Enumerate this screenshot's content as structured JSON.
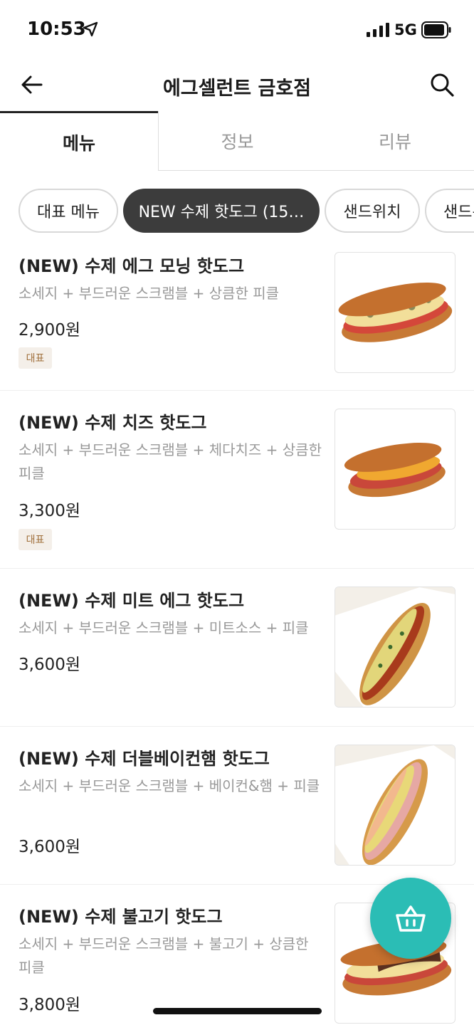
{
  "status": {
    "time": "10:53",
    "network": "5G"
  },
  "header": {
    "title": "에그셀런트 금호점"
  },
  "tabs": [
    {
      "label": "메뉴",
      "active": true
    },
    {
      "label": "정보",
      "active": false
    },
    {
      "label": "리뷰",
      "active": false
    }
  ],
  "chips": [
    {
      "label": "대표 메뉴",
      "active": false
    },
    {
      "label": "NEW 수제 핫도그 (15…",
      "active": true
    },
    {
      "label": "샌드위치",
      "active": false
    },
    {
      "label": "샌드위",
      "active": false
    }
  ],
  "menu_items": [
    {
      "name": "(NEW) 수제 에그 모닝 핫도그",
      "description": "소세지 + 부드러운 스크램블 + 상큼한 피클",
      "price": "2,900원",
      "badge": "대표"
    },
    {
      "name": "(NEW) 수제 치즈 핫도그",
      "description": "소세지 + 부드러운 스크램블 + 체다치즈 + 상큼한 피클",
      "price": "3,300원",
      "badge": "대표"
    },
    {
      "name": "(NEW) 수제 미트 에그 핫도그",
      "description": "소세지 + 부드러운 스크램블 + 미트소스 + 피클",
      "price": "3,600원",
      "badge": ""
    },
    {
      "name": "(NEW) 수제 더블베이컨햄 핫도그",
      "description": "소세지 + 부드러운 스크램블 + 베이컨&햄 + 피클",
      "price": "3,600원",
      "badge": ""
    },
    {
      "name": "(NEW) 수제 불고기 핫도그",
      "description": "소세지 + 부드러운 스크램블 + 불고기 + 상큼한 피클",
      "price": "3,800원",
      "badge": ""
    }
  ],
  "colors": {
    "accent": "#2bbdb5",
    "active_chip": "#3c3c3c",
    "badge_bg": "#f4efe9",
    "badge_text": "#a0703c"
  },
  "icons": {
    "back": "arrow-left-icon",
    "search": "search-icon",
    "cart": "basket-icon",
    "location": "location-arrow-icon",
    "signal": "signal-icon",
    "battery": "battery-icon"
  }
}
